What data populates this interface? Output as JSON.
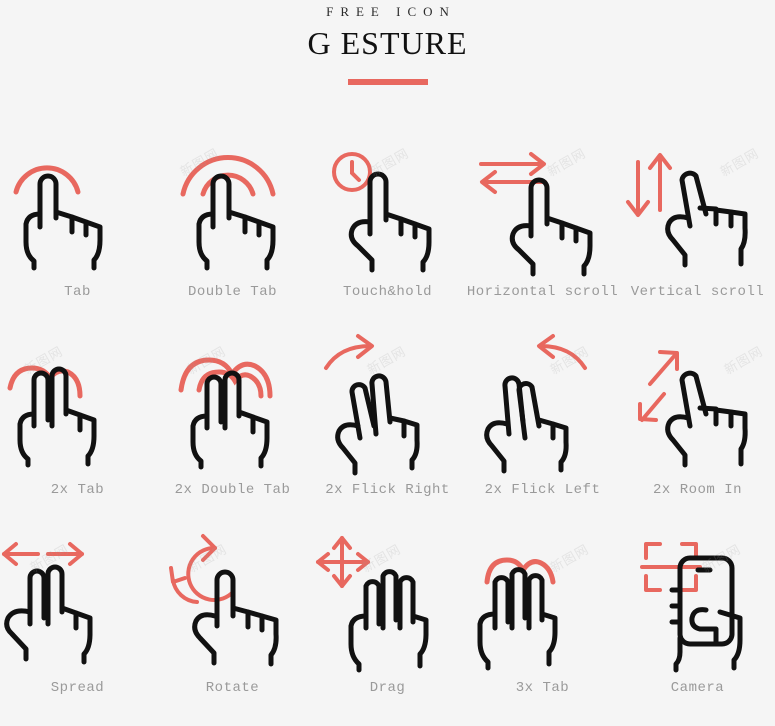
{
  "header": {
    "kicker": "FREE ICON",
    "title": "G ESTURE",
    "accent_color": "#e8685f",
    "background_color": "#f5f5f5",
    "label_color": "#9a9a9a",
    "stroke_color": "#111111"
  },
  "watermark": {
    "text": "新图网"
  },
  "grid": {
    "columns": 5,
    "rows": 3,
    "items": [
      {
        "label": "Tab",
        "icon": "one-finger-tap-icon",
        "fingers": 1,
        "indicator": "single-arc"
      },
      {
        "label": "Double Tab",
        "icon": "one-finger-double-tap-icon",
        "fingers": 1,
        "indicator": "double-arc"
      },
      {
        "label": "Touch&hold",
        "icon": "touch-and-hold-icon",
        "fingers": 1,
        "indicator": "clock"
      },
      {
        "label": "Horizontal scroll",
        "icon": "horizontal-scroll-icon",
        "fingers": 1,
        "indicator": "left-right-arrows"
      },
      {
        "label": "Vertical scroll",
        "icon": "vertical-scroll-icon",
        "fingers": 1,
        "indicator": "up-down-arrows"
      },
      {
        "label": "2x Tab",
        "icon": "two-finger-tap-icon",
        "fingers": 2,
        "indicator": "single-arc"
      },
      {
        "label": "2x Double Tab",
        "icon": "two-finger-double-tap-icon",
        "fingers": 2,
        "indicator": "double-arc"
      },
      {
        "label": "2x Flick Right",
        "icon": "two-finger-flick-right-icon",
        "fingers": 2,
        "indicator": "curved-arrow-right"
      },
      {
        "label": "2x Flick Left",
        "icon": "two-finger-flick-left-icon",
        "fingers": 2,
        "indicator": "curved-arrow-left"
      },
      {
        "label": "2x Room In",
        "icon": "two-finger-zoom-in-icon",
        "fingers": 1,
        "indicator": "diagonal-arrows"
      },
      {
        "label": "Spread",
        "icon": "spread-icon",
        "fingers": 2,
        "indicator": "outward-arrows"
      },
      {
        "label": "Rotate",
        "icon": "rotate-icon",
        "fingers": 1,
        "indicator": "circular-arrow"
      },
      {
        "label": "Drag",
        "icon": "drag-icon",
        "fingers": 3,
        "indicator": "four-way-arrows"
      },
      {
        "label": "3x Tab",
        "icon": "three-finger-tap-icon",
        "fingers": 3,
        "indicator": "single-arc"
      },
      {
        "label": "Camera",
        "icon": "camera-icon",
        "fingers": 0,
        "indicator": "scan-frame"
      }
    ]
  }
}
